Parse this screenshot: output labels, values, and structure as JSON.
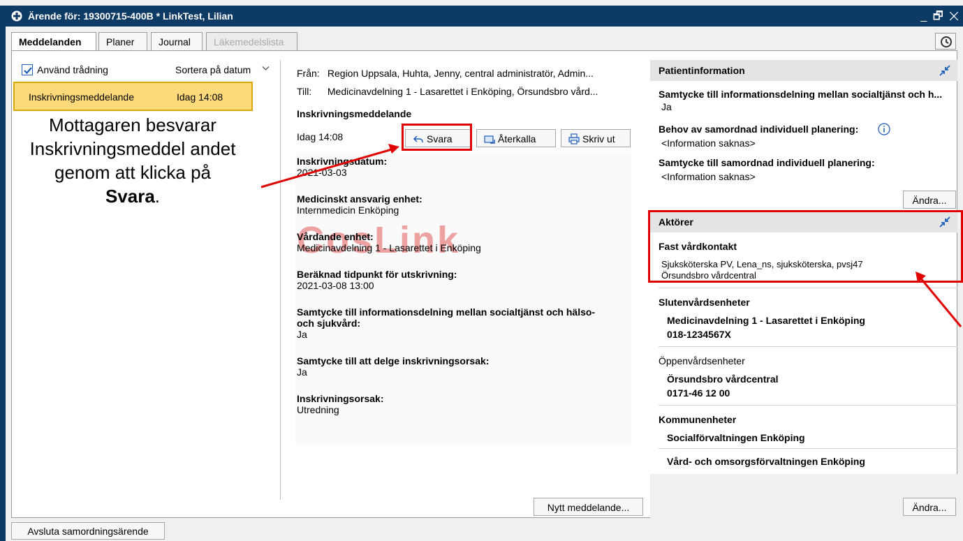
{
  "window": {
    "title": "Ärende för: 19300715-400B * LinkTest, Lilian",
    "controls": "_ 🗗 ✕"
  },
  "tabs": [
    {
      "label": "Meddelanden",
      "active": true
    },
    {
      "label": "Planer"
    },
    {
      "label": "Journal"
    },
    {
      "label": "Läkemedelslista",
      "disabled": true
    }
  ],
  "left_panel": {
    "threading_label": "Använd trådning",
    "threading_checked": true,
    "sort_label": "Sortera på datum",
    "messages": [
      {
        "label": "Inskrivningsmeddelande",
        "time": "Idag 14:08",
        "selected": true
      }
    ]
  },
  "annotation": {
    "text": "Mottagaren besvarar Inskrivningsmeddel andet genom att klicka på ",
    "bold": "Svara",
    "end": "."
  },
  "message": {
    "from_label": "Från:",
    "from": "Region Uppsala, Huhta, Jenny, central administratör, Admin...",
    "to_label": "Till:",
    "to": "Medicinavdelning 1 - Lasarettet i Enköping, Örsundsbro vård...",
    "subject": "Inskrivningsmeddelande",
    "date": "Idag 14:08",
    "actions": {
      "reply": "Svara",
      "recall": "Återkalla",
      "print": "Skriv ut"
    },
    "watermark": "CosLink",
    "fields": [
      {
        "label": "Inskrivningsdatum:",
        "value": "2021-03-03"
      },
      {
        "label": "Medicinskt ansvarig enhet:",
        "value": "Internmedicin Enköping"
      },
      {
        "label": "Vårdande enhet:",
        "value": "Medicinavdelning 1 - Lasarettet i Enköping"
      },
      {
        "label": "Beräknad tidpunkt för utskrivning:",
        "value": "2021-03-08  13:00"
      },
      {
        "label": "Samtycke till informationsdelning mellan socialtjänst och hälso-",
        "label2": "och sjukvård:",
        "value": "Ja"
      },
      {
        "label": "Samtycke till att delge inskrivningsorsak:",
        "value": "Ja"
      },
      {
        "label": "Inskrivningsorsak:",
        "value": "Utredning"
      }
    ],
    "new_message_button": "Nytt meddelande..."
  },
  "patient_info": {
    "header": "Patientinformation",
    "items": [
      {
        "label": "Samtycke till informationsdelning mellan socialtjänst och h...",
        "value": "Ja"
      },
      {
        "label": "Behov av samordnad individuell planering:",
        "value": "<Information saknas>"
      },
      {
        "label": "Samtycke till samordnad individuell planering:",
        "value": "<Information saknas>"
      }
    ],
    "edit_button": "Ändra..."
  },
  "actors": {
    "header": "Aktörer",
    "fast_vardkontakt_label": "Fast vårdkontakt",
    "fast_vardkontakt_line1": "Sjuksköterska PV, Lena_ns, sjuksköterska, pvsj47",
    "fast_vardkontakt_line2": "Örsundsbro vårdcentral",
    "sluten_label": "Slutenvårdsenheter",
    "sluten_name": "Medicinavdelning 1 - Lasarettet i Enköping",
    "sluten_phone": "018-1234567X",
    "oppen_label": "Öppenvårdsenheter",
    "oppen_name": "Örsundsbro vårdcentral",
    "oppen_phone": "0171-46 12 00",
    "kommun_label": "Kommunenheter",
    "kommun_1": "Socialförvaltningen Enköping",
    "kommun_2": "Vård- och omsorgsförvaltningen Enköping",
    "edit_button": "Ändra..."
  },
  "footer": {
    "close_case_button": "Avsluta samordningsärende"
  },
  "colors": {
    "titlebar": "#0e3a66",
    "selected_message": "#fcd97a",
    "highlight_red": "#e00000",
    "watermark": "#e14a4a",
    "icon_blue": "#1e5db8"
  }
}
